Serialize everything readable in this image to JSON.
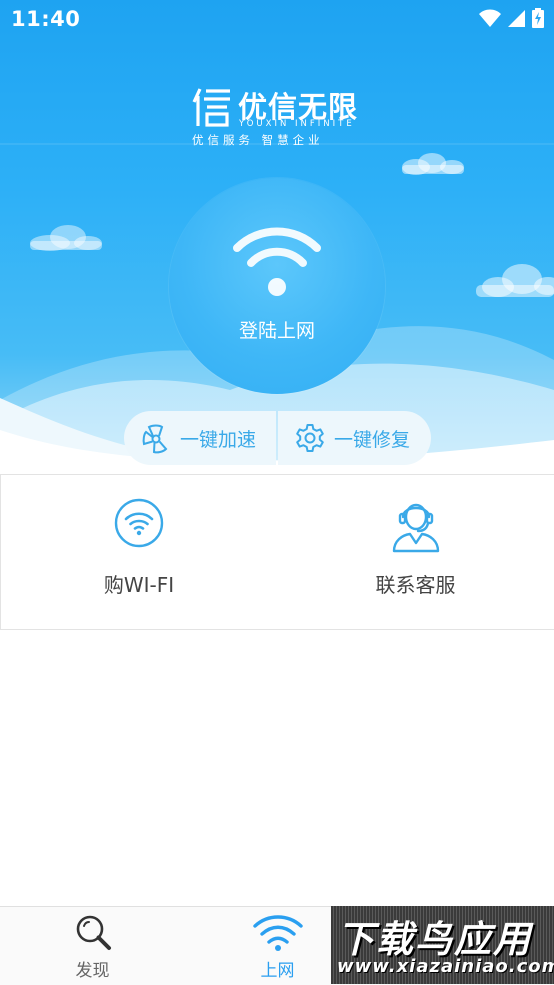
{
  "status_bar": {
    "time": "11:40",
    "icons": [
      "wifi-icon",
      "cell-signal-icon",
      "battery-charging-icon"
    ]
  },
  "brand": {
    "name": "优信无限",
    "english": "YOUXIN INFINITE",
    "slogan": "优信服务 智慧企业"
  },
  "login": {
    "label": "登陆上网",
    "icon": "wifi-icon"
  },
  "quick_actions": [
    {
      "label": "一键加速",
      "icon": "fan-icon"
    },
    {
      "label": "一键修复",
      "icon": "gear-icon"
    }
  ],
  "tiles": [
    {
      "label": "购WI-FI",
      "icon": "wifi-circle-icon"
    },
    {
      "label": "联系客服",
      "icon": "customer-service-icon"
    }
  ],
  "tab_bar": {
    "tabs": [
      {
        "label": "发现",
        "icon": "search-icon",
        "active": false
      },
      {
        "label": "上网",
        "icon": "wifi-icon",
        "active": true
      }
    ]
  },
  "watermark": {
    "title": "下载鸟应用",
    "url": "www.xiazainiao.com"
  },
  "colors": {
    "primary_blue": "#2db0f7",
    "accent_text": "#3aa9e8",
    "active_tab": "#2a9ff0"
  }
}
